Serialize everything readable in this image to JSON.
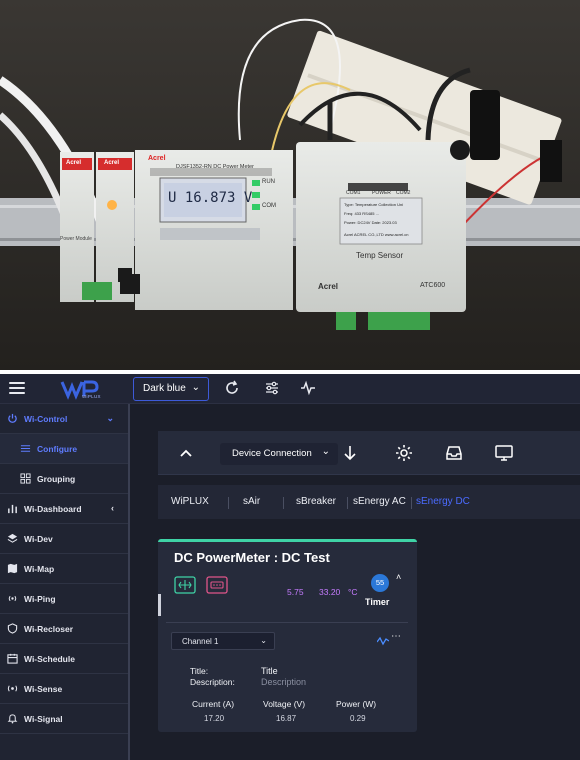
{
  "photo": {
    "power_meter_brand": "Acrel",
    "power_meter_model": "DJSF1352-RN DC Power Meter",
    "lcd_reading": "U 16.873 V",
    "meter_led_labels": [
      "RUN",
      "Com"
    ],
    "meter_right_labels": [
      "RUN",
      "COM"
    ],
    "sensor_brand": "Acrel",
    "sensor_model": "ATC600",
    "sensor_name": "Temp Sensor",
    "sensor_leds": [
      "COM1",
      "POWER",
      "COM2"
    ],
    "label_lines": [
      "Type: Temperature Collection Uni",
      "Freq: 433  RS485 ...",
      "Power: DC24V   Date: 2023.03",
      "Acrel  ACREL CO.,LTD  www.acrel.cn"
    ],
    "small_module_brand": "Acrel",
    "small_module_label": "Power Module"
  },
  "topbar": {
    "theme": "Dark blue",
    "logo_text": "WiPLUX"
  },
  "sidebar": {
    "items": [
      {
        "label": "Wi-Control",
        "icon": "power-icon",
        "state": "active-parent",
        "caret": "⌄"
      },
      {
        "label": "Configure",
        "icon": "sliders-icon",
        "state": "active-child"
      },
      {
        "label": "Grouping",
        "icon": "grid-icon",
        "state": "sub"
      },
      {
        "label": "Wi-Dashboard",
        "icon": "bar-chart-icon",
        "caret": "‹"
      },
      {
        "label": "Wi-Dev",
        "icon": "layers-icon"
      },
      {
        "label": "Wi-Map",
        "icon": "map-icon"
      },
      {
        "label": "Wi-Ping",
        "icon": "signal-icon"
      },
      {
        "label": "Wi-Recloser",
        "icon": "shield-icon"
      },
      {
        "label": "Wi-Schedule",
        "icon": "calendar-icon"
      },
      {
        "label": "Wi-Sense",
        "icon": "sense-icon"
      },
      {
        "label": "Wi-Signal",
        "icon": "bell-icon"
      }
    ]
  },
  "toolbar": {
    "device_connection": "Device Connection"
  },
  "tabs": [
    "WiPLUX",
    "sAir",
    "sBreaker",
    "sEnergy AC",
    "sEnergy DC"
  ],
  "card": {
    "title": "DC PowerMeter : DC Test",
    "stat_a": "5.75",
    "stat_b": "33.20",
    "stat_b_unit": "°C",
    "timer_badge": "55",
    "timer_label": "Timer",
    "channel": "Channel 1",
    "title_label": "Title:",
    "title_value": "Title",
    "description_label": "Description:",
    "description_value": "Description",
    "columns": [
      {
        "head": "Current (A)",
        "value": "17.20"
      },
      {
        "head": "Voltage (V)",
        "value": "16.87"
      },
      {
        "head": "Power (W)",
        "value": "0.29"
      }
    ]
  },
  "colors": {
    "accent": "#4b6bff",
    "card_top": "#3fd3a6",
    "purple_stat": "#c67cff",
    "timer_badge": "#2b78d8"
  }
}
